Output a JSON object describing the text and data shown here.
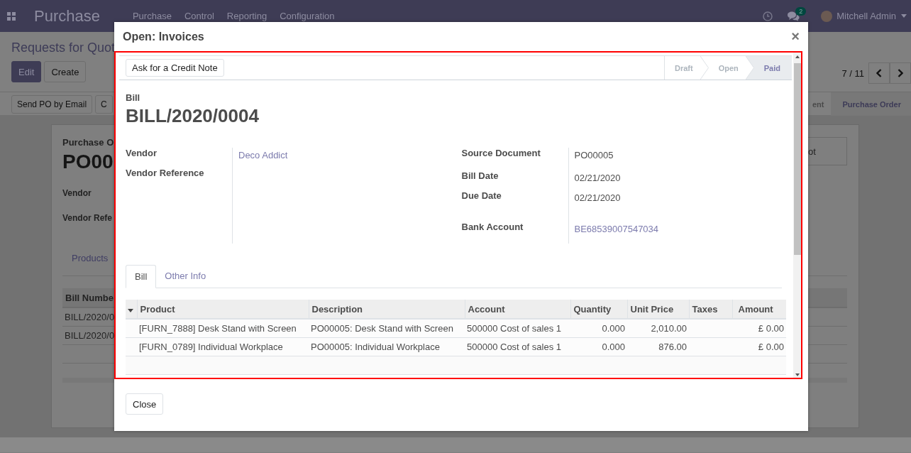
{
  "navbar": {
    "app_name": "Purchase",
    "menu": [
      "Purchase",
      "Control",
      "Reporting",
      "Configuration"
    ],
    "message_count": "2",
    "user": "Mitchell Admin"
  },
  "background": {
    "breadcrumb": "Requests for Quot",
    "buttons": [
      {
        "label": "Edit",
        "kind": "primary"
      },
      {
        "label": "Create",
        "kind": "secondary"
      }
    ],
    "pager": "7 / 11",
    "actions": [
      "Send PO by Email",
      "C"
    ],
    "stages": [
      {
        "label": "ent",
        "selected": false
      },
      {
        "label": "Purchase Order",
        "selected": true
      }
    ],
    "sheet": {
      "label": "Purchase O",
      "title": "PO00",
      "fields": [
        "Vendor",
        "Vendor Refe"
      ],
      "smart_button": "ot",
      "tab": "Products",
      "table_header": "Bill Numbe",
      "rows": [
        "BILL/2020/0",
        "BILL/2020/0"
      ]
    }
  },
  "dialog": {
    "title": "Open: Invoices",
    "close": "×",
    "header_button": "Ask for a Credit Note",
    "stages": [
      {
        "label": "Draft",
        "selected": false
      },
      {
        "label": "Open",
        "selected": false
      },
      {
        "label": "Paid",
        "selected": true
      }
    ],
    "doc_type": "Bill",
    "doc_number": "BILL/2020/0004",
    "left_fields": [
      {
        "label": "Vendor",
        "value": "Deco Addict",
        "link": true
      },
      {
        "label": "Vendor Reference"
      }
    ],
    "right_fields": [
      {
        "label": "Source Document",
        "value": "PO00005",
        "link": false
      },
      {
        "label": "Bill Date",
        "value": "02/21/2020",
        "link": false
      },
      {
        "label": "Due Date",
        "value": "02/21/2020",
        "link": false
      },
      {
        "label": "Bank Account",
        "value": "BE68539007547034",
        "link": true
      }
    ],
    "tabs": [
      {
        "label": "Bill",
        "selected": true
      },
      {
        "label": "Other Info",
        "selected": false
      }
    ],
    "table": {
      "columns": [
        "Product",
        "Description",
        "Account",
        "Quantity",
        "Unit Price",
        "Taxes",
        "Amount"
      ],
      "rows": [
        [
          "[FURN_7888] Desk Stand with Screen",
          "PO00005: Desk Stand with Screen",
          "500000 Cost of sales 1",
          "0.000",
          "2,010.00",
          "",
          "£ 0.00"
        ],
        [
          "[FURN_0789] Individual Workplace",
          "PO00005: Individual Workplace",
          "500000 Cost of sales 1",
          "0.000",
          "876.00",
          "",
          "£ 0.00"
        ]
      ]
    },
    "footer_button": "Close"
  }
}
